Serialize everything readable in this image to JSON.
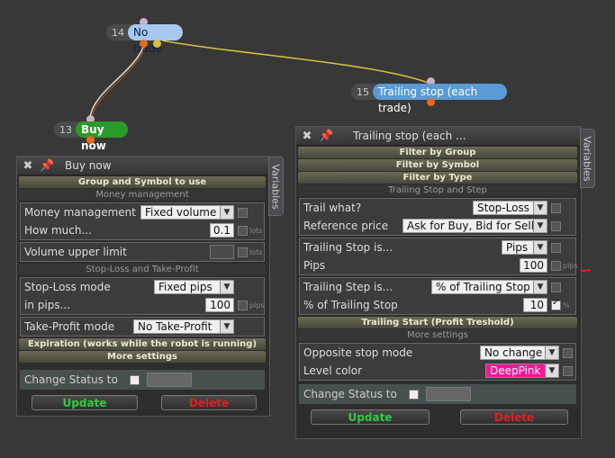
{
  "colors": {
    "update": "#2ecc40",
    "delete": "#e02020",
    "deeppink": "#ff1493",
    "wire_orange": "#e36b1f",
    "wire_yellow": "#d9c040",
    "node_blue": "#5b9bd5",
    "node_green": "#2a9a2a"
  },
  "nodes": [
    {
      "num": "14",
      "label": "No trade"
    },
    {
      "num": "15",
      "label": "Trailing stop (each trade)"
    },
    {
      "num": "13",
      "label": "Buy now"
    }
  ],
  "buy_panel": {
    "title": "Buy now",
    "variables_tab": "Variables",
    "section_group": "Group and Symbol to use",
    "sub_money": "Money management",
    "money_management_label": "Money management",
    "money_management_value": "Fixed volume",
    "how_much_label": "How much...",
    "how_much_value": "0.1",
    "how_much_unit": "lots",
    "volume_upper_label": "Volume upper limit",
    "volume_upper_unit": "lots",
    "sub_sltp": "Stop-Loss and Take-Profit",
    "sl_mode_label": "Stop-Loss mode",
    "sl_mode_value": "Fixed pips",
    "in_pips_label": "in pips...",
    "in_pips_value": "100",
    "in_pips_unit": "pips",
    "tp_mode_label": "Take-Profit mode",
    "tp_mode_value": "No Take-Profit",
    "section_expiration": "Expiration (works while the robot is running)",
    "section_more": "More settings",
    "change_status_label": "Change Status to",
    "update_label": "Update",
    "delete_label": "Delete"
  },
  "trail_panel": {
    "title": "Trailing stop (each ...",
    "variables_tab": "Variables",
    "filter_group": "Filter by Group",
    "filter_symbol": "Filter by Symbol",
    "filter_type": "Filter by Type",
    "sub_trailing": "Trailing Stop and Step",
    "trail_what_label": "Trail what?",
    "trail_what_value": "Stop-Loss",
    "ref_price_label": "Reference price",
    "ref_price_value": "Ask for Buy, Bid for Sell",
    "ts_is_label": "Trailing Stop is...",
    "ts_is_value": "Pips",
    "pips_label": "Pips",
    "pips_value": "100",
    "pips_unit": "pips",
    "tstep_label": "Trailing Step is...",
    "tstep_value": "% of Trailing Stop",
    "pct_label": "% of Trailing Stop",
    "pct_value": "10",
    "pct_unit": "%",
    "section_start": "Trailing Start (Profit Treshold)",
    "sub_more": "More settings",
    "opposite_label": "Opposite stop mode",
    "opposite_value": "No change",
    "level_color_label": "Level color",
    "level_color_value": "DeepPink",
    "change_status_label": "Change Status to",
    "update_label": "Update",
    "delete_label": "Delete"
  }
}
